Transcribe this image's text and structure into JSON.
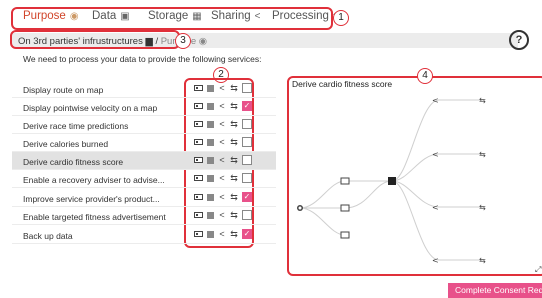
{
  "tabs": [
    {
      "label": "Purpose",
      "icon": "target-icon",
      "active": true
    },
    {
      "label": "Data",
      "icon": "data-card-icon",
      "active": false
    },
    {
      "label": "Storage",
      "icon": "storage-icon",
      "active": false
    },
    {
      "label": "Sharing",
      "icon": "share-icon",
      "active": false
    },
    {
      "label": "Processing",
      "icon": "processing-icon",
      "active": false
    }
  ],
  "badges": {
    "b1": "1",
    "b2": "2",
    "b3": "3",
    "b4": "4"
  },
  "breadcrumb": {
    "root": "On 3rd parties' infrustructures",
    "separator": "/",
    "current": "Purpose"
  },
  "help_label": "?",
  "intro": "We need to process your data to provide the following services:",
  "services": [
    {
      "label": "Display route on map",
      "checked": false
    },
    {
      "label": "Display pointwise velocity on a map",
      "checked": true
    },
    {
      "label": "Derive race time predictions",
      "checked": false
    },
    {
      "label": "Derive calories burned",
      "checked": false
    },
    {
      "label": "Derive cardio fitness score",
      "checked": false,
      "selected": true
    },
    {
      "label": "Enable a recovery adviser to advise...",
      "checked": false
    },
    {
      "label": "Improve service provider's product...",
      "checked": true
    },
    {
      "label": "Enable targeted fitness advertisement",
      "checked": false
    },
    {
      "label": "Back up data",
      "checked": true
    }
  ],
  "graph": {
    "title": "Derive cardio fitness score"
  },
  "cta_label": "Complete Consent Request",
  "colors": {
    "accent_red": "#e0303a",
    "pink": "#e8518a",
    "tab_active": "#d1452a"
  }
}
